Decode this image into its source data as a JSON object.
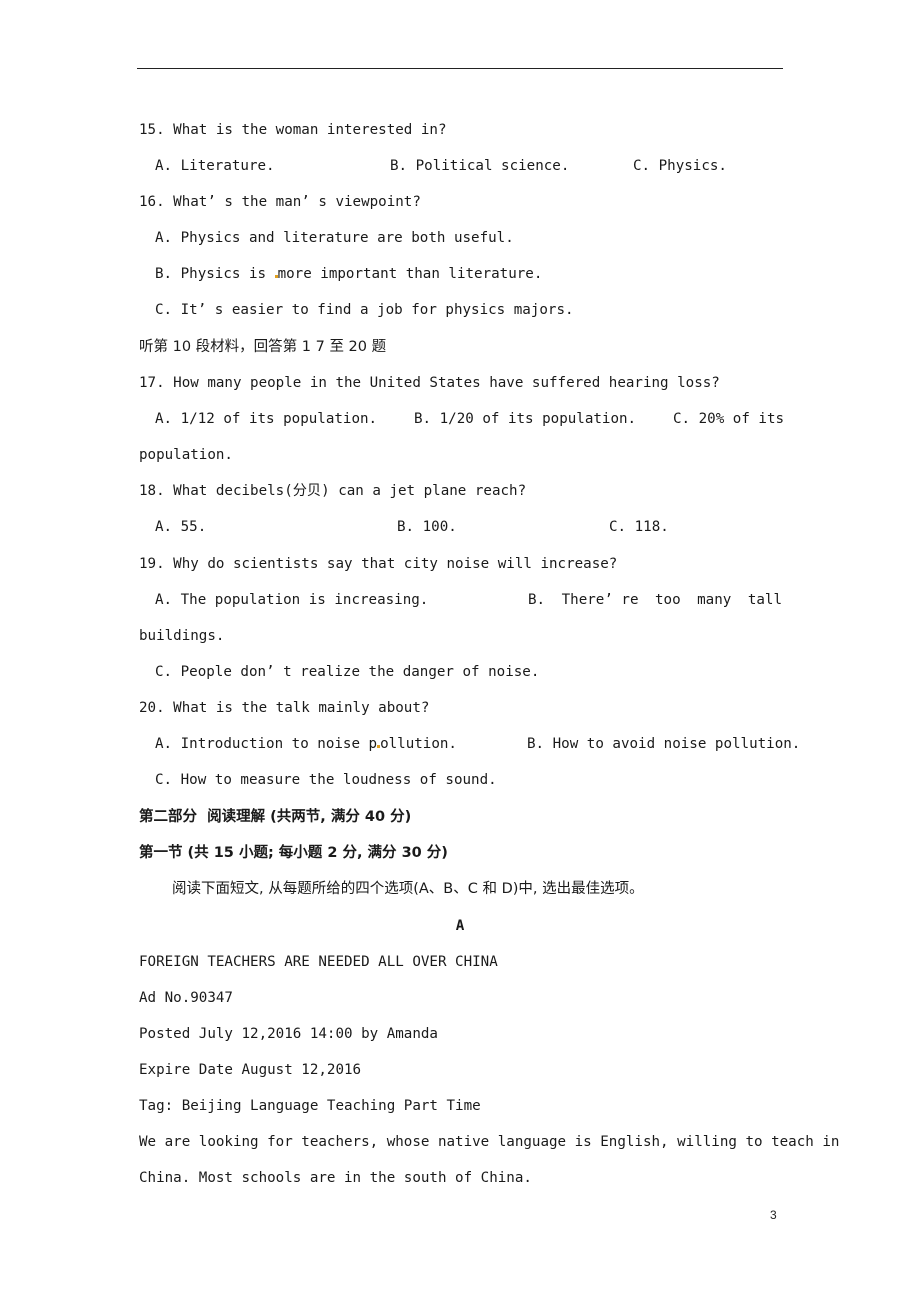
{
  "questions": [
    {
      "stem": "15. What is the woman interested in?",
      "options": {
        "A": "A. Literature.",
        "B": "B. Political science.",
        "C": "C. Physics."
      }
    },
    {
      "stem": "16. What’ s the man’ s viewpoint?",
      "options": {
        "A": "A. Physics and literature are both useful.",
        "B_pre": "B. Physics is ",
        "B_post": "more important than literature.",
        "C": "C. It’ s easier to find a job for physics majors."
      }
    },
    {
      "stem": "17. How many people in the United States have suffered hearing loss?",
      "options": {
        "A": "A. 1/12 of its population.",
        "B": "B. 1/20 of its population.",
        "C": "C. 20% of its",
        "C_cont": "population."
      }
    },
    {
      "stem": "18. What decibels(分贝) can a jet plane reach?",
      "options": {
        "A": "A. 55.",
        "B": "B. 100.",
        "C": "C. 118."
      }
    },
    {
      "stem": "19. Why do scientists say that city noise will increase?",
      "options": {
        "A": "A. The population is increasing.",
        "B_words": [
          "B.",
          "There’ re",
          "too",
          "many",
          "tall"
        ],
        "B_cont": "buildings.",
        "C": "C. People don’ t realize the danger of noise."
      }
    },
    {
      "stem": "20. What is the talk mainly about?",
      "options": {
        "A_pre": "A. Introduction to noise p",
        "A_post": "ollution.",
        "B": "B. How to avoid noise pollution.",
        "C": "C. How to measure the loudness of sound."
      }
    }
  ],
  "listening_instruction": "听第 10 段材料，回答第 1 7 至 20 题",
  "part_two": {
    "title": "第二部分  阅读理解 (共两节, 满分 40 分)",
    "section_one": "第一节 (共 15 小题; 每小题 2 分, 满分 30 分)",
    "instruction": "阅读下面短文, 从每题所给的四个选项(A、B、C 和 D)中, 选出最佳选项。",
    "passage_label": "A"
  },
  "passage": {
    "headline": "FOREIGN TEACHERS ARE NEEDED ALL OVER CHINA",
    "ad_no": "Ad No.90347",
    "posted": "Posted July 12,2016 14:00 by Amanda",
    "expire": "Expire Date August 12,2016",
    "tag": "Tag: Beijing Language Teaching Part Time",
    "body_line1": "We are looking for teachers, whose native language is English, willing to teach in",
    "body_line2": "China. Most schools are in the south of China."
  },
  "page_number": "3"
}
